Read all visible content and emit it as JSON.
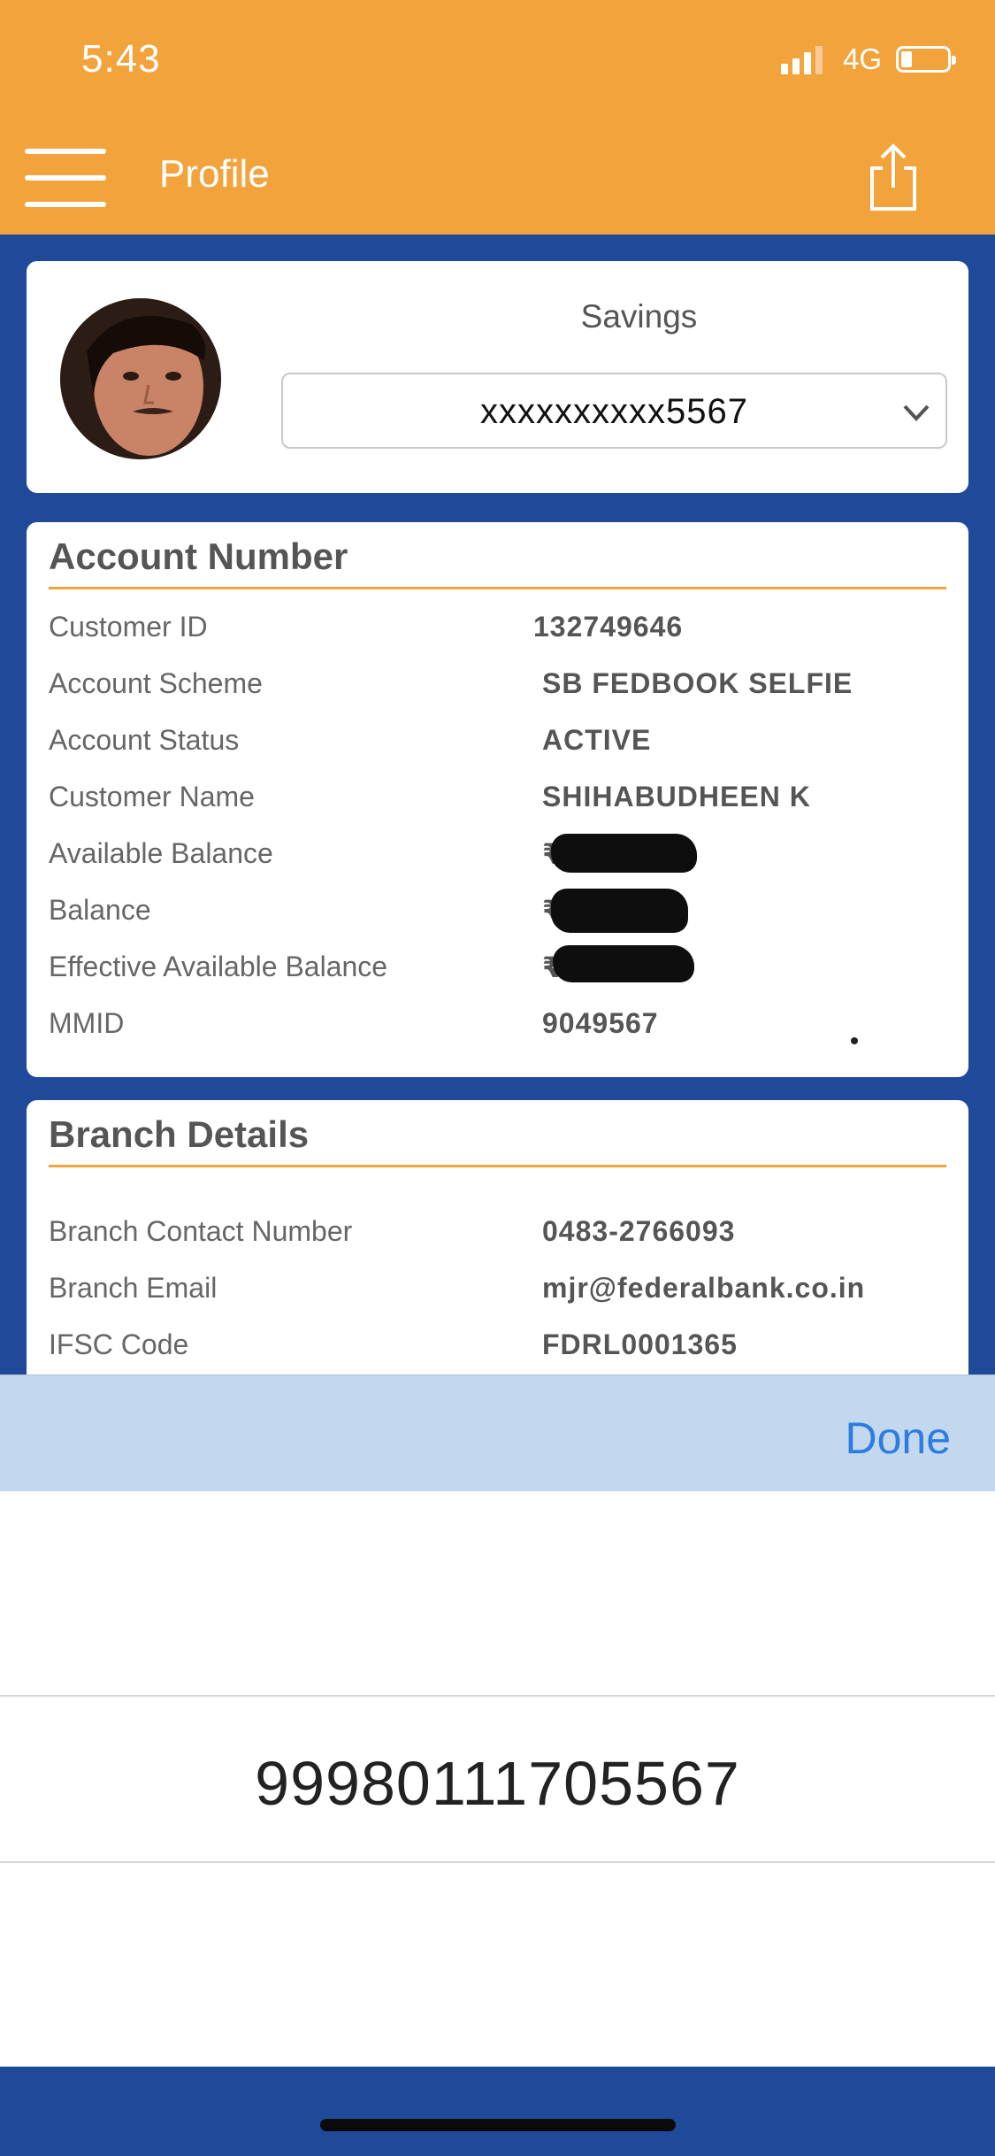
{
  "status_bar": {
    "time": "5:43",
    "network": "4G"
  },
  "header": {
    "title": "Profile"
  },
  "account_selector": {
    "type_label": "Savings",
    "selected": "xxxxxxxxxx5567"
  },
  "account_section": {
    "title": "Account Number",
    "rows": [
      {
        "label": "Customer ID",
        "value": "132749646"
      },
      {
        "label": "Account Scheme",
        "value": "SB FEDBOOK SELFIE"
      },
      {
        "label": "Account Status",
        "value": "ACTIVE"
      },
      {
        "label": "Customer Name",
        "value": "SHIHABUDHEEN K"
      },
      {
        "label": "Available Balance",
        "value": "₹"
      },
      {
        "label": "Balance",
        "value": "₹"
      },
      {
        "label": "Effective Available Balance",
        "value": "₹"
      },
      {
        "label": "MMID",
        "value": "9049567"
      }
    ]
  },
  "branch_section": {
    "title": "Branch Details",
    "rows": [
      {
        "label": "Branch Contact Number",
        "value": "0483-2766093"
      },
      {
        "label": "Branch Email",
        "value": "mjr@federalbank.co.in"
      },
      {
        "label": "IFSC Code",
        "value": "FDRL0001365"
      }
    ]
  },
  "picker": {
    "done_label": "Done",
    "selected_value": "99980111705567"
  },
  "colors": {
    "header": "#f2a33c",
    "background": "#1f4a9a",
    "accent_line": "#f2a33c",
    "done": "#2c7de0",
    "picker_bar": "#c3d8ef"
  }
}
